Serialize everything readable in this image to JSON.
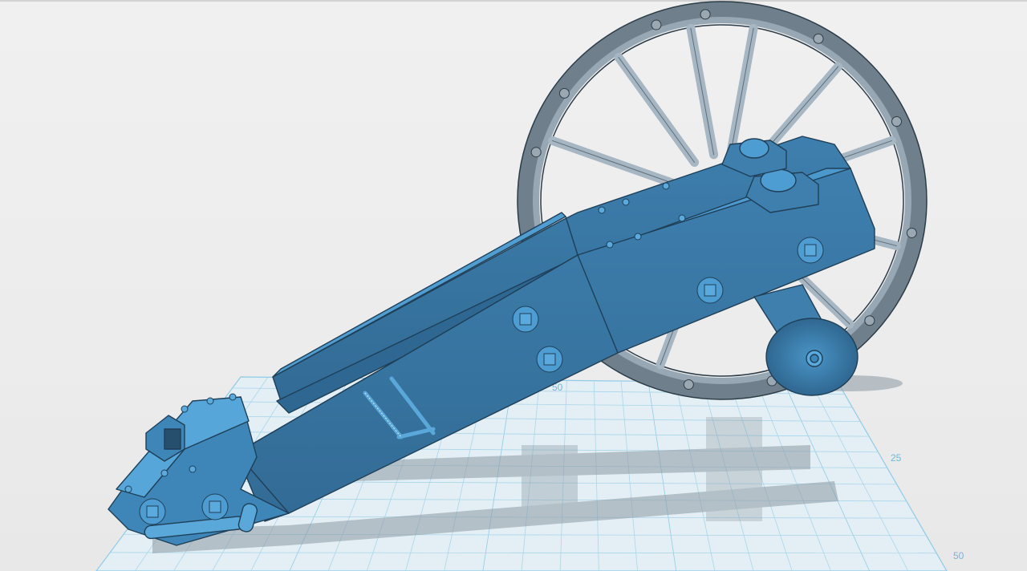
{
  "viewport": {
    "background": "#ececec",
    "grid_color": "#8fcbe6",
    "grid_fill": "#e6f1f6"
  },
  "grid": {
    "labels": {
      "label_50_back": "50",
      "label_25_side": "25",
      "label_50_side": "50"
    }
  },
  "model": {
    "part_color": "#3f7fae",
    "part_top_color": "#4d9dd2",
    "wheel_color": "#7c8a96",
    "spoke_color": "#a6b6c2"
  }
}
